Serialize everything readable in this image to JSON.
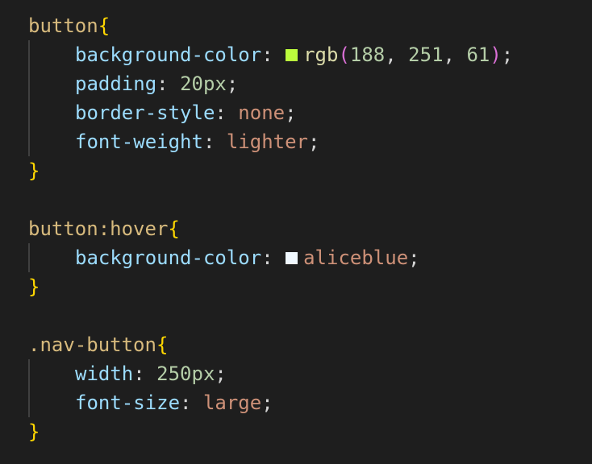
{
  "colors": {
    "background": "#1e1e1e",
    "selector": "#d7ba7d",
    "brace": "#ffd700",
    "property": "#9cdcfe",
    "number": "#b5cea8",
    "keyword_value": "#ce9178",
    "function": "#dcdcaa",
    "paren": "#da70d6",
    "swatch_green": "#bcfb3d",
    "swatch_aliceblue": "#f0f8ff"
  },
  "rule1": {
    "selector": "button",
    "open_brace": "{",
    "close_brace": "}",
    "d1": {
      "prop": "background-color",
      "fn": "rgb",
      "open_paren": "(",
      "r": "188",
      "g": "251",
      "b": "61",
      "close_paren": ")"
    },
    "d2": {
      "prop": "padding",
      "value": "20px"
    },
    "d3": {
      "prop": "border-style",
      "value": "none"
    },
    "d4": {
      "prop": "font-weight",
      "value": "lighter"
    }
  },
  "rule2": {
    "selector": "button:hover",
    "open_brace": "{",
    "close_brace": "}",
    "d1": {
      "prop": "background-color",
      "value": "aliceblue"
    }
  },
  "rule3": {
    "selector": ".nav-button",
    "open_brace": "{",
    "close_brace": "}",
    "d1": {
      "prop": "width",
      "value": "250px"
    },
    "d2": {
      "prop": "font-size",
      "value": "large"
    }
  }
}
